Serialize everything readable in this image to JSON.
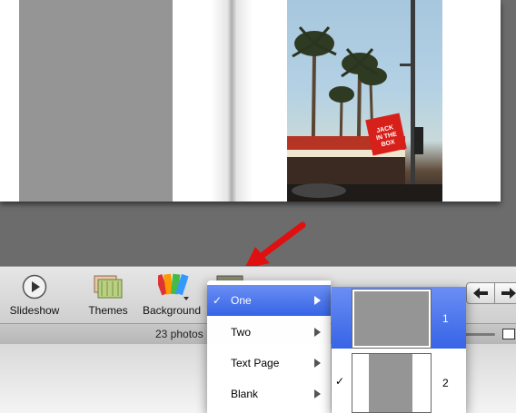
{
  "toolbar": {
    "slideshow_label": "Slideshow",
    "themes_label": "Themes",
    "background_label": "Background"
  },
  "status": {
    "photo_count": "23 photos"
  },
  "layout_menu": {
    "items": [
      {
        "label": "One",
        "checked": true,
        "selected": true
      },
      {
        "label": "Two",
        "checked": false,
        "selected": false
      },
      {
        "label": "Text Page",
        "checked": false,
        "selected": false
      },
      {
        "label": "Blank",
        "checked": false,
        "selected": false
      }
    ],
    "check_mark": "✓"
  },
  "submenu": {
    "options": [
      {
        "label": "1",
        "checked": false,
        "selected": true
      },
      {
        "label": "2",
        "checked": true,
        "selected": false
      }
    ],
    "check_mark": "✓"
  },
  "colors": {
    "selection_blue": "#3764e6",
    "annotation_red": "#e01010",
    "placeholder_gray": "#959595"
  },
  "icons": {
    "slideshow": "play-icon",
    "themes": "themes-icon",
    "background": "palette-icon",
    "layout": "layout-icon",
    "prev": "arrow-left-icon",
    "next": "arrow-right-icon"
  }
}
